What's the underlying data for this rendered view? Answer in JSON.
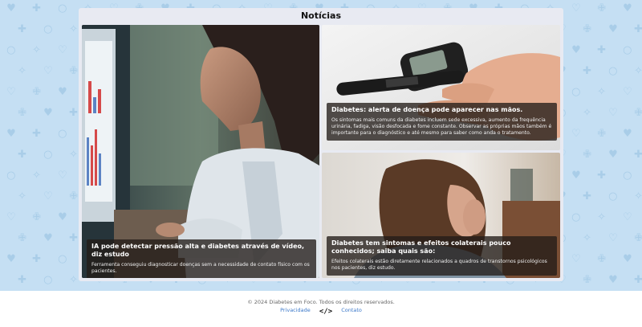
{
  "section": {
    "title": "Notícias"
  },
  "news": [
    {
      "title": "IA pode detectar pressão alta e diabetes através de vídeo, diz estudo",
      "description": "Ferramenta conseguiu diagnosticar doenças sem a necessidade de contato físico com os pacientes."
    },
    {
      "title": "Diabetes: alerta de doença pode aparecer nas mãos.",
      "description": "Os sintomas mais comuns da diabetes incluem sede excessiva, aumento da frequência urinária, fadiga, visão desfocada e fome constante. Observar as próprias mãos também é importante para o diagnóstico e até mesmo para saber como anda o tratamento."
    },
    {
      "title": "Diabetes tem sintomas e efeitos colaterais pouco conhecidos; saiba quais são:",
      "description": "Efeitos colaterais estão diretamente relacionados a quadros de transtornos psicológicos nos pacientes, diz estudo."
    }
  ],
  "footer": {
    "copyright": "© 2024 Diabetes em Foco. Todos os direitos reservados.",
    "privacy": "Privacidade",
    "code_icon": "code-icon",
    "contact": "Contato"
  },
  "colors": {
    "background": "#c5dff3",
    "panel": "#e8eaf2",
    "link": "#3b78c9"
  }
}
